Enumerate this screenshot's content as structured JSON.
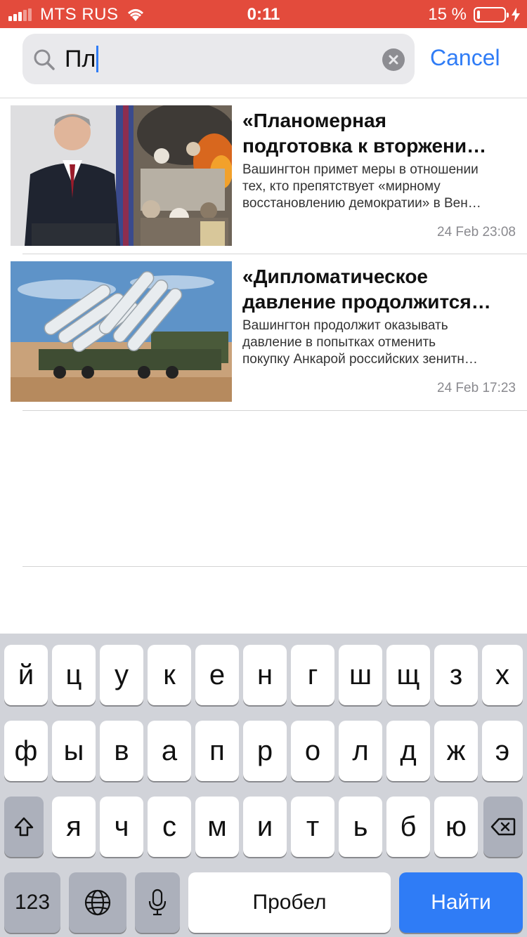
{
  "status_bar": {
    "carrier": "MTS RUS",
    "time": "0:11",
    "battery_percent": "15 %",
    "battery_level": 0.15,
    "accent_color": "#e34b3c"
  },
  "search": {
    "query": "Пл",
    "cancel_label": "Cancel",
    "icon": "search-icon",
    "clear_icon": "clear-icon"
  },
  "results": [
    {
      "title_line1": "«Планомерная",
      "title_line2": "подготовка к вторжени…",
      "desc_line1": "Вашингтон примет меры в отношении",
      "desc_line2": "тех, кто препятствует «мирному",
      "desc_line3": "восстановлению демократии» в Вен…",
      "time": "24 Feb 23:08"
    },
    {
      "title_line1": "«Дипломатическое",
      "title_line2": "давление продолжится…",
      "desc_line1": "Вашингтон продолжит оказывать",
      "desc_line2": "давление в попытках отменить",
      "desc_line3": "покупку Анкарой российских зенитн…",
      "time": "24 Feb 17:23"
    }
  ],
  "keyboard": {
    "row1": [
      "й",
      "ц",
      "у",
      "к",
      "е",
      "н",
      "г",
      "ш",
      "щ",
      "з",
      "х"
    ],
    "row2": [
      "ф",
      "ы",
      "в",
      "а",
      "п",
      "р",
      "о",
      "л",
      "д",
      "ж",
      "э"
    ],
    "row3": [
      "я",
      "ч",
      "с",
      "м",
      "и",
      "т",
      "ь",
      "б",
      "ю"
    ],
    "numbers_label": "123",
    "space_label": "Пробел",
    "go_label": "Найти",
    "go_color": "#2f7cf6"
  }
}
